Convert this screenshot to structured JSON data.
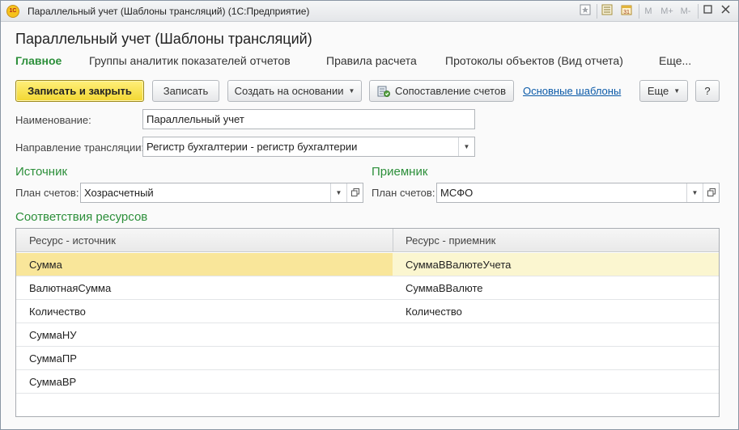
{
  "window": {
    "title": "Параллельный учет (Шаблоны трансляций)  (1С:Предприятие)",
    "app_icon_text": "1С",
    "title_buttons": [
      "M",
      "M+",
      "M-"
    ]
  },
  "form": {
    "title": "Параллельный учет (Шаблоны трансляций)"
  },
  "nav": {
    "main": "Главное",
    "groups": "Группы аналитик показателей отчетов",
    "rules": "Правила расчета",
    "protocols": "Протоколы объектов (Вид отчета)",
    "more": "Еще..."
  },
  "toolbar": {
    "save_close": "Записать и закрыть",
    "save": "Записать",
    "create_based": "Создать на основании",
    "accounts_mapping": "Сопоставление счетов",
    "main_templates": "Основные шаблоны",
    "more": "Еще",
    "help": "?"
  },
  "fields": {
    "name_label": "Наименование:",
    "name_value": "Параллельный учет",
    "direction_label": "Направление трансляции:",
    "direction_value": "Регистр бухгалтерии - регистр бухгалтерии"
  },
  "source": {
    "title": "Источник",
    "chart_label": "План счетов:",
    "chart_value": "Хозрасчетный"
  },
  "receiver": {
    "title": "Приемник",
    "chart_label": "План счетов:",
    "chart_value": "МСФО"
  },
  "resources": {
    "title": "Соответствия ресурсов",
    "columns": [
      "Ресурс - источник",
      "Ресурс - приемник"
    ],
    "rows": [
      [
        "Сумма",
        "СуммаВВалютеУчета"
      ],
      [
        "ВалютнаяСумма",
        "СуммаВВалюте"
      ],
      [
        "Количество",
        "Количество"
      ],
      [
        "СуммаНУ",
        ""
      ],
      [
        "СуммаПР",
        ""
      ],
      [
        "СуммаВР",
        ""
      ]
    ],
    "selected_row": 0
  }
}
